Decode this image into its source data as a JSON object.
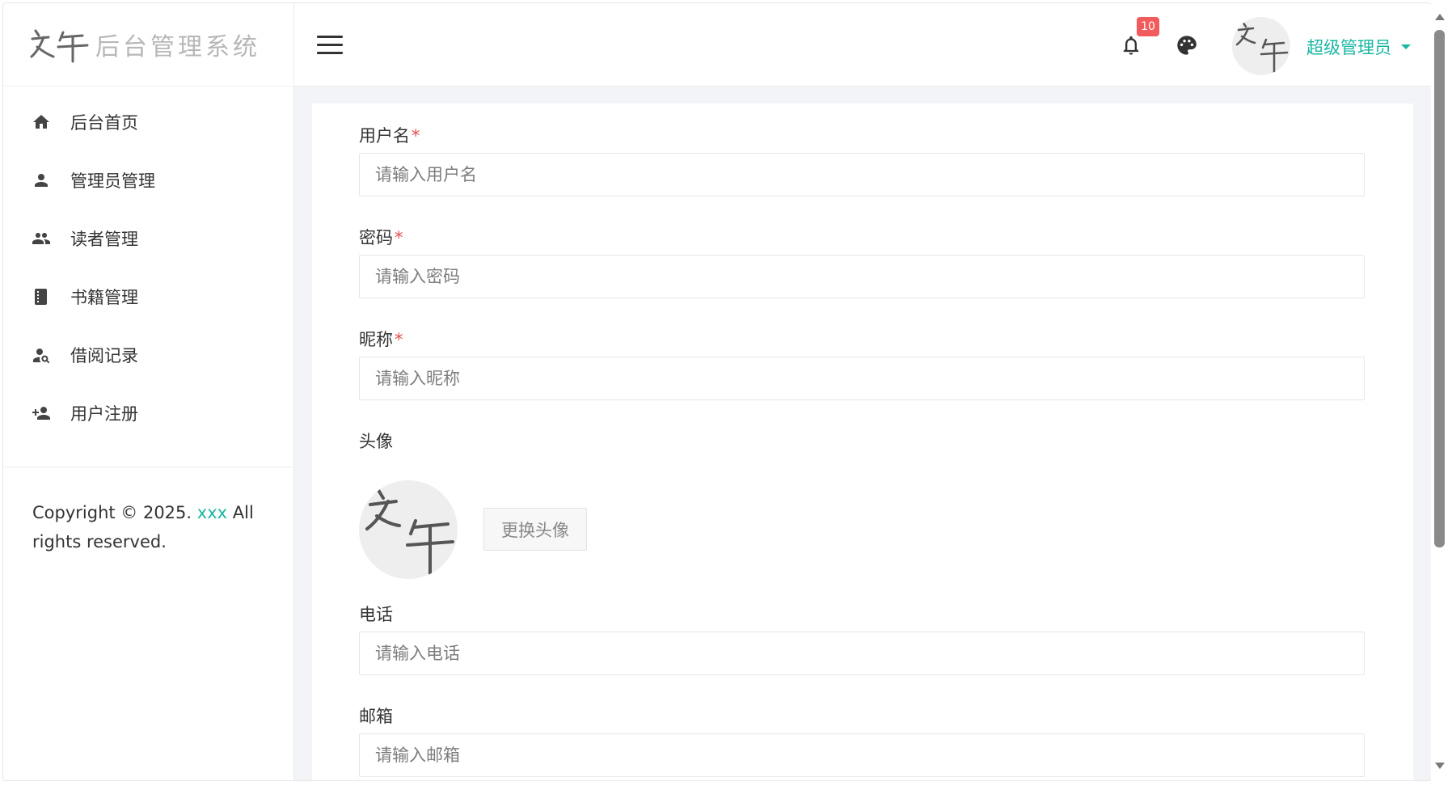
{
  "brand": {
    "logo_text": "之午",
    "title": "后台管理系统"
  },
  "sidebar": {
    "items": [
      {
        "label": "后台首页",
        "icon": "home-icon"
      },
      {
        "label": "管理员管理",
        "icon": "person-icon"
      },
      {
        "label": "读者管理",
        "icon": "people-icon"
      },
      {
        "label": "书籍管理",
        "icon": "book-icon"
      },
      {
        "label": "借阅记录",
        "icon": "person-search-icon"
      },
      {
        "label": "用户注册",
        "icon": "person-add-icon"
      }
    ],
    "copyright_prefix": "Copyright © 2025. ",
    "copyright_link": "xxx",
    "copyright_suffix": " All rights reserved."
  },
  "header": {
    "notification_count": "10",
    "user_name": "超级管理员",
    "accent_color": "#19b6a2",
    "badge_color": "#f25b5b"
  },
  "form": {
    "username": {
      "label": "用户名",
      "required_mark": "*",
      "placeholder": "请输入用户名"
    },
    "password": {
      "label": "密码",
      "required_mark": "*",
      "placeholder": "请输入密码"
    },
    "nickname": {
      "label": "昵称",
      "required_mark": "*",
      "placeholder": "请输入昵称"
    },
    "avatar": {
      "label": "头像",
      "button_label": "更换头像"
    },
    "phone": {
      "label": "电话",
      "placeholder": "请输入电话"
    },
    "email": {
      "label": "邮箱",
      "placeholder": "请输入邮箱"
    }
  }
}
